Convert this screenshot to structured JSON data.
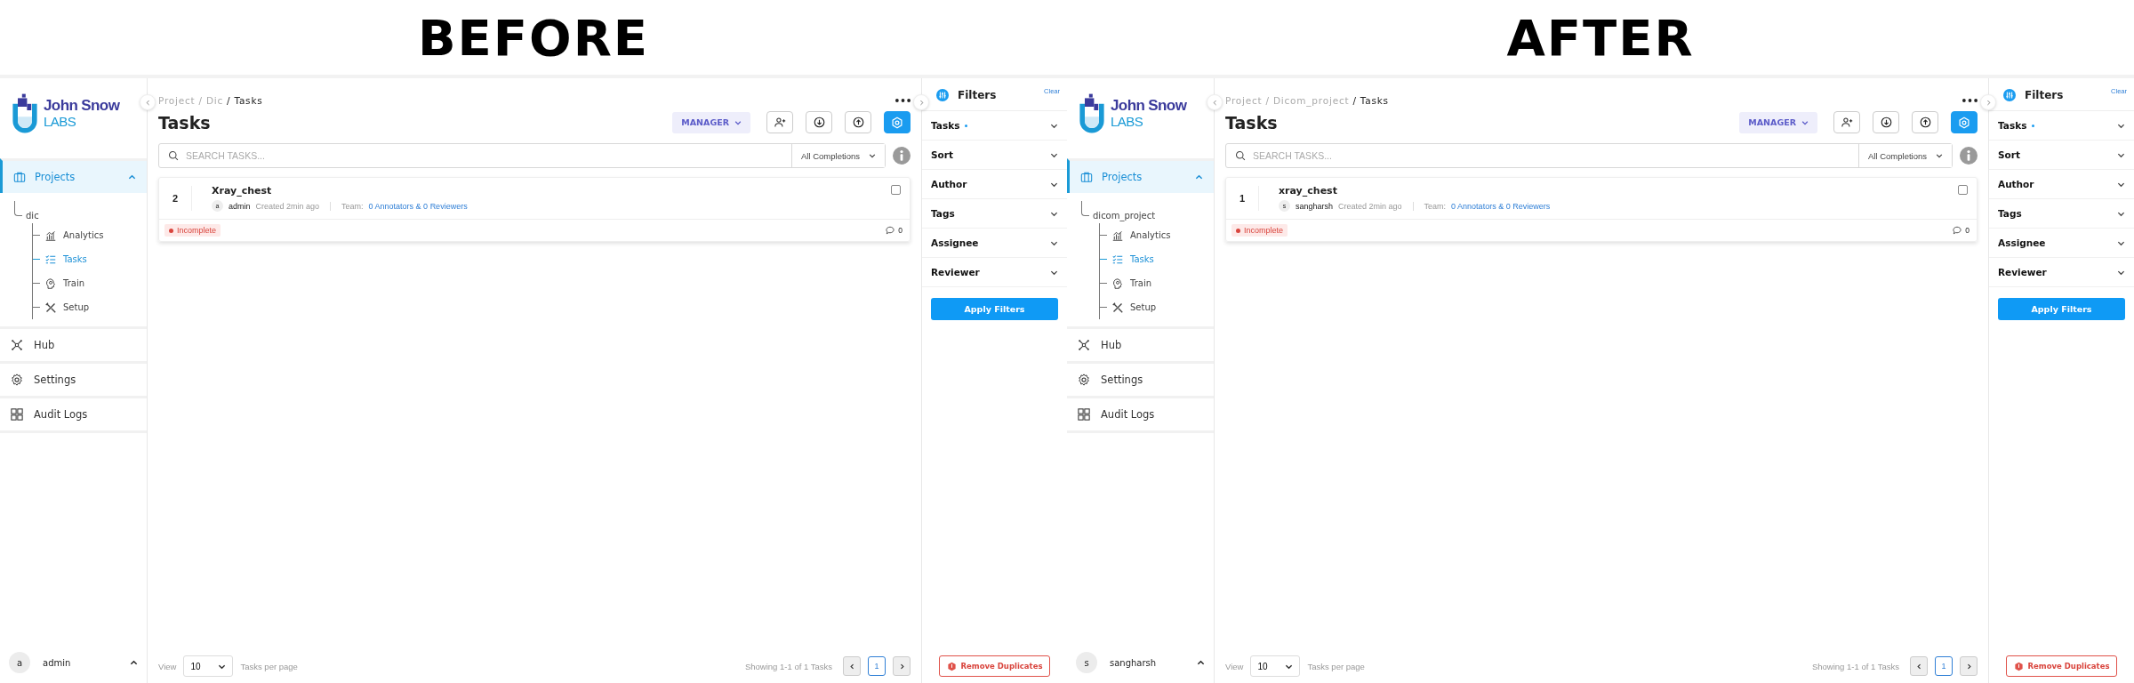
{
  "panels": [
    {
      "heading": "BEFORE",
      "logo": {
        "name": "John Snow",
        "sub": "LABS"
      },
      "nav": {
        "projects": {
          "label": "Projects",
          "selected": true,
          "expanded": true
        },
        "project": "dic",
        "children": [
          {
            "label": "Analytics",
            "selected": false
          },
          {
            "label": "Tasks",
            "selected": true
          },
          {
            "label": "Train",
            "selected": false
          },
          {
            "label": "Setup",
            "selected": false
          }
        ],
        "items": [
          {
            "label": "Hub"
          },
          {
            "label": "Settings"
          },
          {
            "label": "Audit Logs"
          }
        ]
      },
      "user": {
        "initial": "a",
        "name": "admin"
      },
      "breadcrumb": {
        "separator": "/",
        "items": [
          "Project",
          "Dic",
          "Tasks"
        ]
      },
      "title": "Tasks",
      "role": "MANAGER",
      "search": {
        "placeholder": "SEARCH TASKS..."
      },
      "completions": "All Completions",
      "tasks": [
        {
          "id": "2",
          "title": "Xray_chest",
          "avatar": "a",
          "author": "admin",
          "created": "Created 2min ago",
          "team_label": "Team:",
          "team": "0 Annotators & 0 Reviewers",
          "status": "Incomplete",
          "comments": "0",
          "checked": false
        }
      ],
      "pagination": {
        "view": "View",
        "per_page": "10",
        "per_page_label": "Tasks per page",
        "showing": "Showing 1-1 of 1 Tasks",
        "pages": [
          {
            "label": "1",
            "selected": true
          }
        ]
      },
      "filters": {
        "title": "Filters",
        "clear": "Clear",
        "sections": [
          {
            "label": "Tasks",
            "active": true
          },
          {
            "label": "Sort",
            "active": false
          },
          {
            "label": "Author",
            "active": false
          },
          {
            "label": "Tags",
            "active": false
          },
          {
            "label": "Assignee",
            "active": false
          },
          {
            "label": "Reviewer",
            "active": false
          }
        ],
        "apply": "Apply Filters",
        "remove": "Remove Duplicates"
      }
    },
    {
      "heading": "AFTER",
      "logo": {
        "name": "John Snow",
        "sub": "LABS"
      },
      "nav": {
        "projects": {
          "label": "Projects",
          "selected": true,
          "expanded": true
        },
        "project": "dicom_project",
        "children": [
          {
            "label": "Analytics",
            "selected": false
          },
          {
            "label": "Tasks",
            "selected": true
          },
          {
            "label": "Train",
            "selected": false
          },
          {
            "label": "Setup",
            "selected": false
          }
        ],
        "items": [
          {
            "label": "Hub"
          },
          {
            "label": "Settings"
          },
          {
            "label": "Audit Logs"
          }
        ]
      },
      "user": {
        "initial": "s",
        "name": "sangharsh"
      },
      "breadcrumb": {
        "separator": "/",
        "items": [
          "Project",
          "Dicom_project",
          "Tasks"
        ]
      },
      "title": "Tasks",
      "role": "MANAGER",
      "search": {
        "placeholder": "SEARCH TASKS..."
      },
      "completions": "All Completions",
      "tasks": [
        {
          "id": "1",
          "title": "xray_chest",
          "avatar": "s",
          "author": "sangharsh",
          "created": "Created 2min ago",
          "team_label": "Team:",
          "team": "0 Annotators & 0 Reviewers",
          "status": "Incomplete",
          "comments": "0",
          "checked": false
        }
      ],
      "pagination": {
        "view": "View",
        "per_page": "10",
        "per_page_label": "Tasks per page",
        "showing": "Showing 1-1 of 1 Tasks",
        "pages": [
          {
            "label": "1",
            "selected": true
          }
        ]
      },
      "filters": {
        "title": "Filters",
        "clear": "Clear",
        "sections": [
          {
            "label": "Tasks",
            "active": true
          },
          {
            "label": "Sort",
            "active": false
          },
          {
            "label": "Author",
            "active": false
          },
          {
            "label": "Tags",
            "active": false
          },
          {
            "label": "Assignee",
            "active": false
          },
          {
            "label": "Reviewer",
            "active": false
          }
        ],
        "apply": "Apply Filters",
        "remove": "Remove Duplicates"
      }
    }
  ]
}
